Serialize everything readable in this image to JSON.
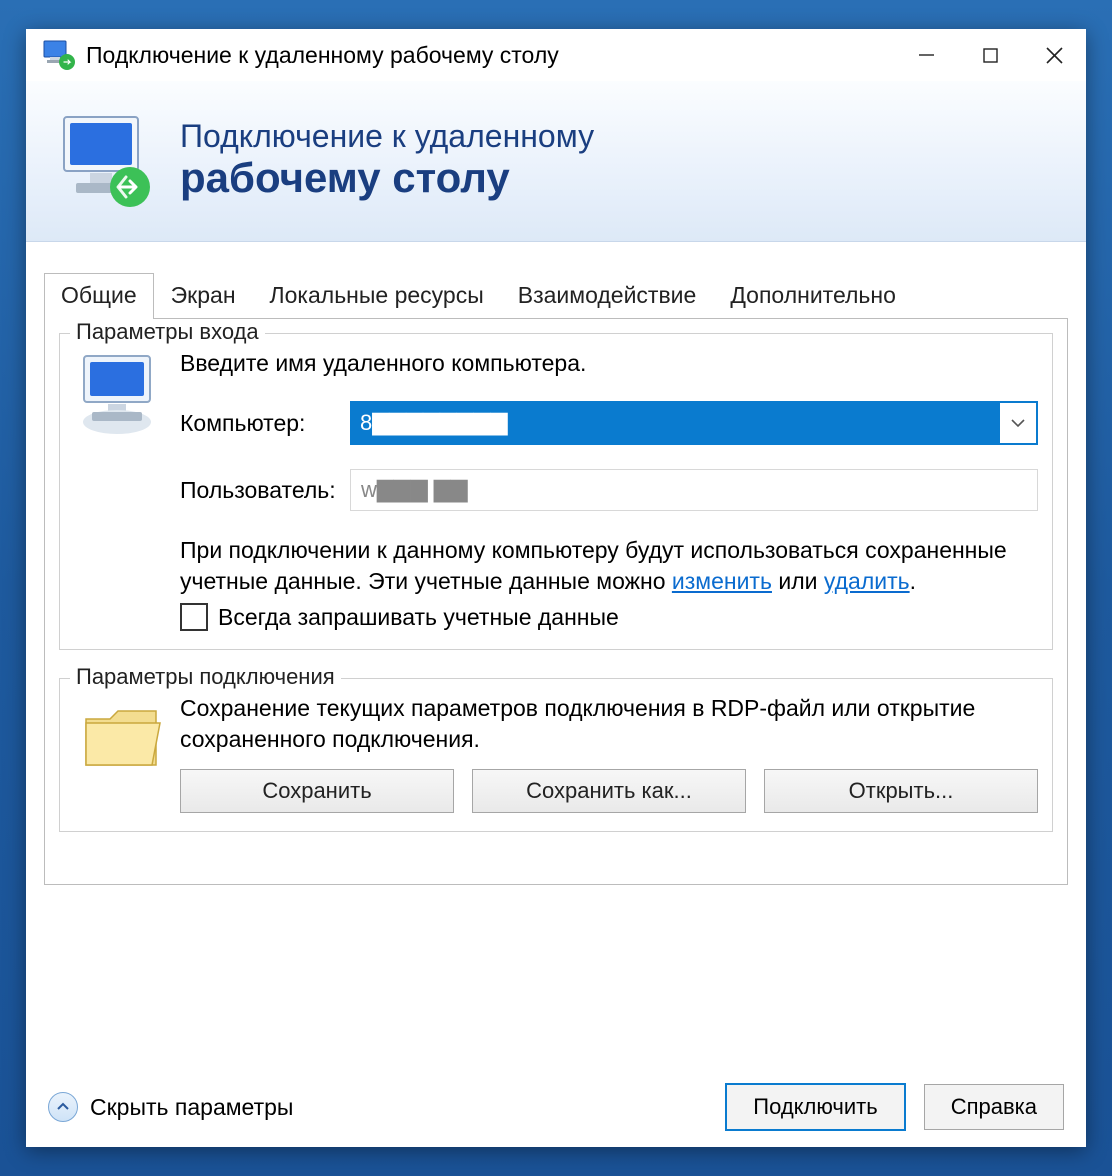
{
  "window": {
    "title": "Подключение к удаленному рабочему столу"
  },
  "banner": {
    "line1": "Подключение к удаленному",
    "line2": "рабочему столу"
  },
  "tabs": [
    {
      "label": "Общие",
      "active": true
    },
    {
      "label": "Экран"
    },
    {
      "label": "Локальные ресурсы"
    },
    {
      "label": "Взаимодействие"
    },
    {
      "label": "Дополнительно"
    }
  ],
  "login_group": {
    "legend": "Параметры входа",
    "instruction": "Введите имя удаленного компьютера.",
    "computer_label": "Компьютер:",
    "computer_value": "8▇▇▇▇▇▇▇▇",
    "user_label": "Пользователь:",
    "user_value": "w▇▇▇  ▇▇",
    "note_prefix": "При подключении к данному компьютеру будут использоваться сохраненные учетные данные.  Эти учетные данные можно ",
    "link_change": "изменить",
    "note_mid": " или ",
    "link_delete": "удалить",
    "note_suffix": ".",
    "checkbox_label": "Всегда запрашивать учетные данные"
  },
  "conn_group": {
    "legend": "Параметры подключения",
    "text": "Сохранение текущих параметров подключения в RDP-файл или открытие сохраненного подключения.",
    "save": "Сохранить",
    "save_as": "Сохранить как...",
    "open": "Открыть..."
  },
  "footer": {
    "hide_options": "Скрыть параметры",
    "connect": "Подключить",
    "help": "Справка"
  }
}
